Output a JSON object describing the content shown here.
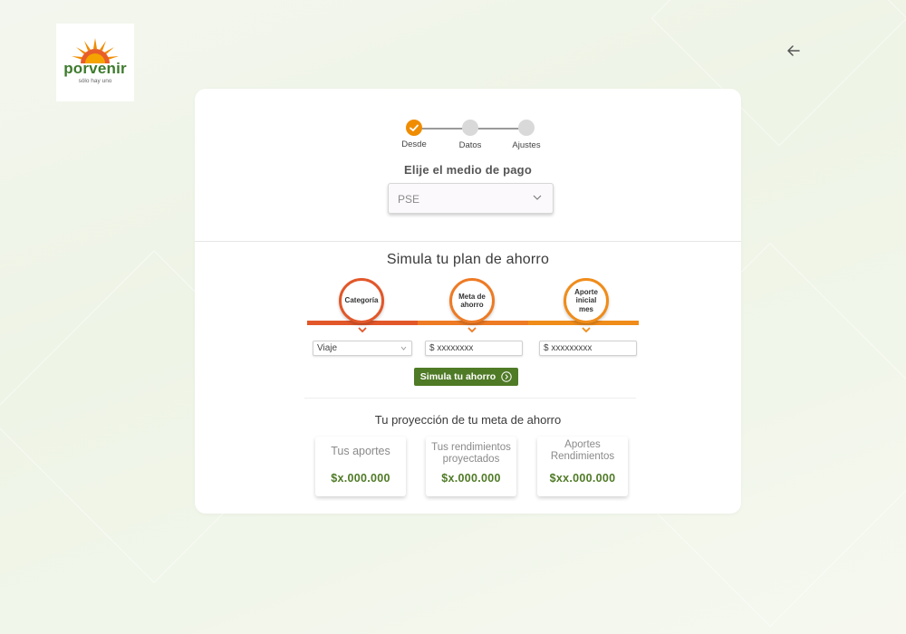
{
  "brand": {
    "name": "porvenir",
    "tagline": "sólo hay uno",
    "colors": {
      "orange": "#f08c00",
      "red_orange": "#e85d2a",
      "green": "#4f7a26"
    }
  },
  "nav": {
    "back_icon": "arrow-left-icon"
  },
  "stepper": {
    "steps": [
      {
        "label": "Desde",
        "state": "completed"
      },
      {
        "label": "Datos",
        "state": "pending"
      },
      {
        "label": "Ajustes",
        "state": "pending"
      }
    ]
  },
  "payment": {
    "title": "Elije el medio de pago",
    "selected": "PSE"
  },
  "simulator": {
    "title": "Simula tu plan de ahorro",
    "circles": [
      "Categoría",
      "Meta de ahorro",
      "Aporte inicial mes"
    ],
    "category_value": "Viaje",
    "goal_value": "$ xxxxxxxx",
    "initial_value": "$ xxxxxxxxx",
    "button_label": "Simula tu ahorro"
  },
  "projection": {
    "title": "Tu proyección de tu meta de ahorro",
    "cards": [
      {
        "label": "Tus aportes",
        "value": "$x.000.000"
      },
      {
        "label": "Tus rendimientos proyectados",
        "value": "$x.000.000"
      },
      {
        "label": "Aportes Rendimientos",
        "value": "$xx.000.000"
      }
    ]
  }
}
